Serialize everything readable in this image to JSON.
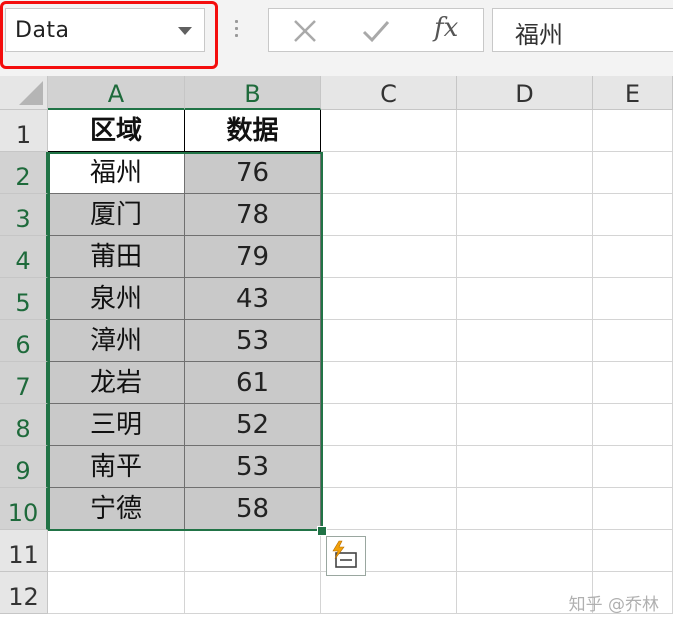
{
  "name_box": {
    "value": "Data"
  },
  "formula_bar": {
    "fx_label": "fx",
    "value": "福州"
  },
  "columns": [
    "A",
    "B",
    "C",
    "D",
    "E"
  ],
  "rows": [
    "1",
    "2",
    "3",
    "4",
    "5",
    "6",
    "7",
    "8",
    "9",
    "10",
    "11",
    "12"
  ],
  "table": {
    "headers": [
      "区域",
      "数据"
    ],
    "rows": [
      [
        "福州",
        "76"
      ],
      [
        "厦门",
        "78"
      ],
      [
        "莆田",
        "79"
      ],
      [
        "泉州",
        "43"
      ],
      [
        "漳州",
        "53"
      ],
      [
        "龙岩",
        "61"
      ],
      [
        "三明",
        "52"
      ],
      [
        "南平",
        "53"
      ],
      [
        "宁德",
        "58"
      ]
    ]
  },
  "watermark": "知乎 @乔林",
  "colors": {
    "selection": "#217346",
    "highlight": "#f40d0d",
    "selected_fill": "#c9c9c9"
  }
}
